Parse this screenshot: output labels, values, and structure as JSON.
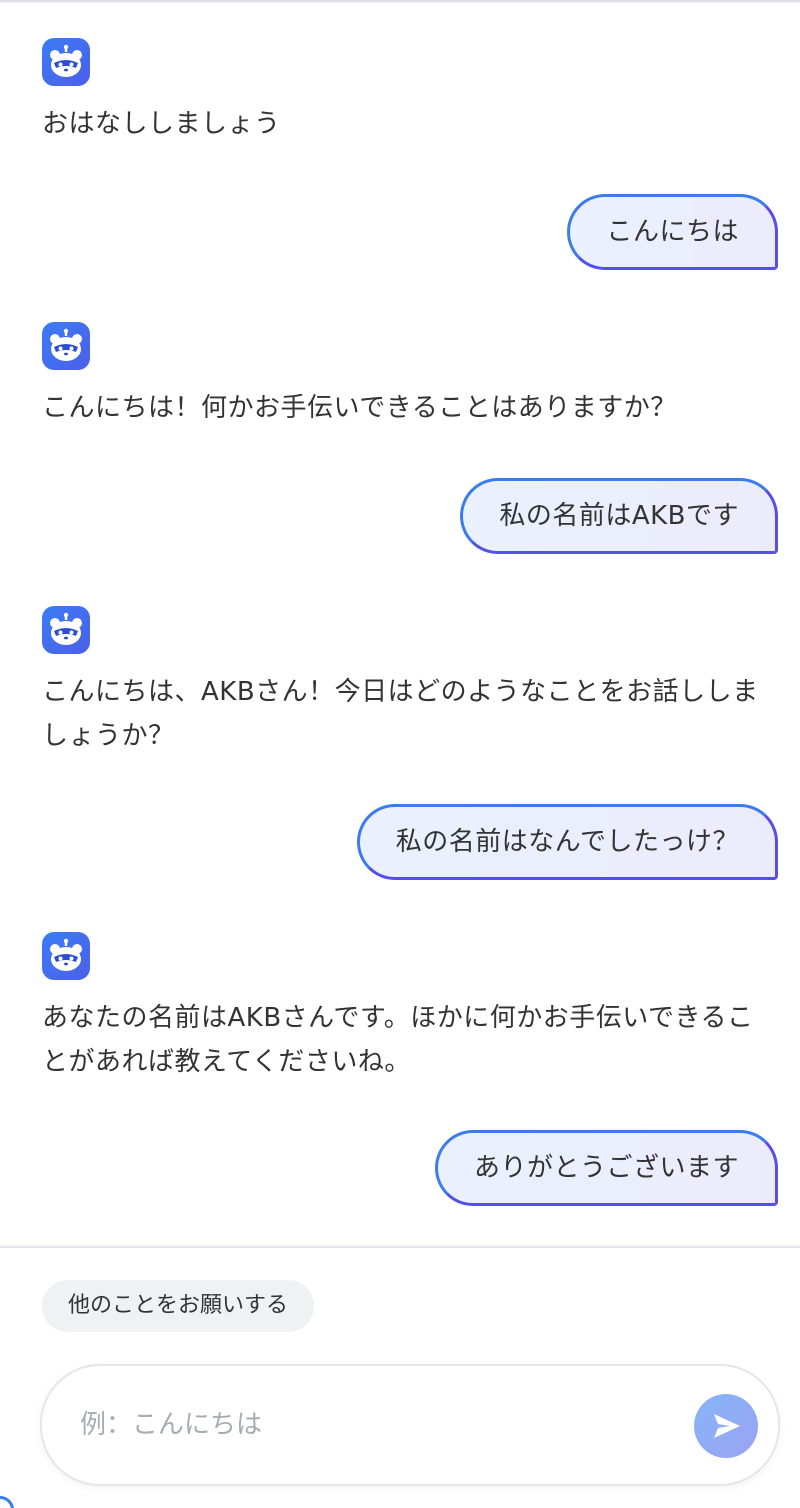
{
  "messages": [
    {
      "role": "bot",
      "text": "おはなししましょう"
    },
    {
      "role": "user",
      "text": "こんにちは"
    },
    {
      "role": "bot",
      "text": "こんにちは！何かお手伝いできることはありますか？"
    },
    {
      "role": "user",
      "text": "私の名前はAKBです"
    },
    {
      "role": "bot",
      "text": "こんにちは、AKBさん！今日はどのようなことをお話ししましょうか？"
    },
    {
      "role": "user",
      "text": "私の名前はなんでしたっけ？"
    },
    {
      "role": "bot",
      "text": "あなたの名前はAKBさんです。ほかに何かお手伝いできることがあれば教えてくださいね。"
    },
    {
      "role": "user",
      "text": "ありがとうございます"
    }
  ],
  "composer": {
    "suggestion": "他のことをお願いする",
    "placeholder": "例：こんにちは",
    "value": ""
  },
  "icons": {
    "bot_avatar": "panda-robot-icon",
    "send": "send-arrow-icon"
  },
  "colors": {
    "accent": "#3a7bf0",
    "accent_secondary": "#5b4ce6",
    "user_bubble_bg": "#eaf1fd",
    "chip_bg": "#f0f1f3"
  }
}
